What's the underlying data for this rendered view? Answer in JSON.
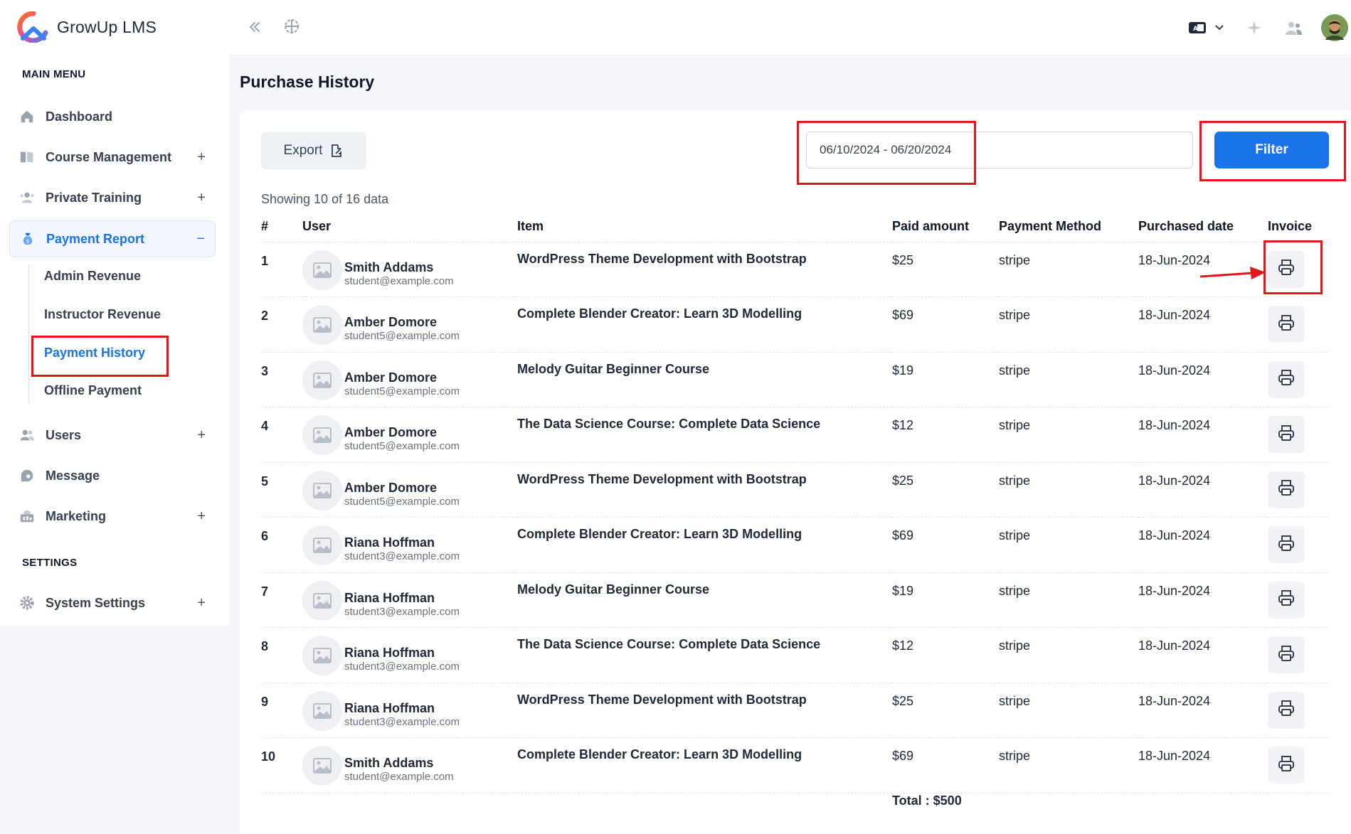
{
  "brand": {
    "name": "GrowUp LMS"
  },
  "sidebar": {
    "main_menu_title": "MAIN MENU",
    "settings_title": "SETTINGS",
    "items": [
      {
        "label": "Dashboard",
        "icon": "home-icon"
      },
      {
        "label": "Course Management",
        "icon": "book-icon",
        "expand": "+"
      },
      {
        "label": "Private Training",
        "icon": "training-icon",
        "expand": "+"
      },
      {
        "label": "Payment Report",
        "icon": "money-bag-icon",
        "expand": "−"
      },
      {
        "label": "Users",
        "icon": "users-icon",
        "expand": "+"
      },
      {
        "label": "Message",
        "icon": "message-icon"
      },
      {
        "label": "Marketing",
        "icon": "marketing-icon",
        "expand": "+"
      },
      {
        "label": "System Settings",
        "icon": "gear-icon",
        "expand": "+"
      }
    ],
    "payment_sub": [
      "Admin Revenue",
      "Instructor Revenue",
      "Payment History",
      "Offline Payment"
    ]
  },
  "page": {
    "title": "Purchase History",
    "export_label": "Export",
    "date_range": "06/10/2024 - 06/20/2024",
    "filter_label": "Filter",
    "showing": "Showing 10 of 16 data"
  },
  "table": {
    "headers": [
      "#",
      "User",
      "Item",
      "Paid amount",
      "Payment Method",
      "Purchased date",
      "Invoice"
    ],
    "rows": [
      {
        "n": "1",
        "name": "Smith Addams",
        "email": "student@example.com",
        "item": "WordPress Theme Development with Bootstrap",
        "amount": "$25",
        "method": "stripe",
        "date": "18-Jun-2024"
      },
      {
        "n": "2",
        "name": "Amber Domore",
        "email": "student5@example.com",
        "item": "Complete Blender Creator: Learn 3D Modelling",
        "amount": "$69",
        "method": "stripe",
        "date": "18-Jun-2024"
      },
      {
        "n": "3",
        "name": "Amber Domore",
        "email": "student5@example.com",
        "item": "Melody Guitar Beginner Course",
        "amount": "$19",
        "method": "stripe",
        "date": "18-Jun-2024"
      },
      {
        "n": "4",
        "name": "Amber Domore",
        "email": "student5@example.com",
        "item": "The Data Science Course: Complete Data Science",
        "amount": "$12",
        "method": "stripe",
        "date": "18-Jun-2024"
      },
      {
        "n": "5",
        "name": "Amber Domore",
        "email": "student5@example.com",
        "item": "WordPress Theme Development with Bootstrap",
        "amount": "$25",
        "method": "stripe",
        "date": "18-Jun-2024"
      },
      {
        "n": "6",
        "name": "Riana Hoffman",
        "email": "student3@example.com",
        "item": "Complete Blender Creator: Learn 3D Modelling",
        "amount": "$69",
        "method": "stripe",
        "date": "18-Jun-2024"
      },
      {
        "n": "7",
        "name": "Riana Hoffman",
        "email": "student3@example.com",
        "item": "Melody Guitar Beginner Course",
        "amount": "$19",
        "method": "stripe",
        "date": "18-Jun-2024"
      },
      {
        "n": "8",
        "name": "Riana Hoffman",
        "email": "student3@example.com",
        "item": "The Data Science Course: Complete Data Science",
        "amount": "$12",
        "method": "stripe",
        "date": "18-Jun-2024"
      },
      {
        "n": "9",
        "name": "Riana Hoffman",
        "email": "student3@example.com",
        "item": "WordPress Theme Development with Bootstrap",
        "amount": "$25",
        "method": "stripe",
        "date": "18-Jun-2024"
      },
      {
        "n": "10",
        "name": "Smith Addams",
        "email": "student@example.com",
        "item": "Complete Blender Creator: Learn 3D Modelling",
        "amount": "$69",
        "method": "stripe",
        "date": "18-Jun-2024"
      }
    ],
    "total": "Total : $500"
  },
  "colors": {
    "accent": "#1a73e8",
    "annotation": "#e3161b"
  }
}
